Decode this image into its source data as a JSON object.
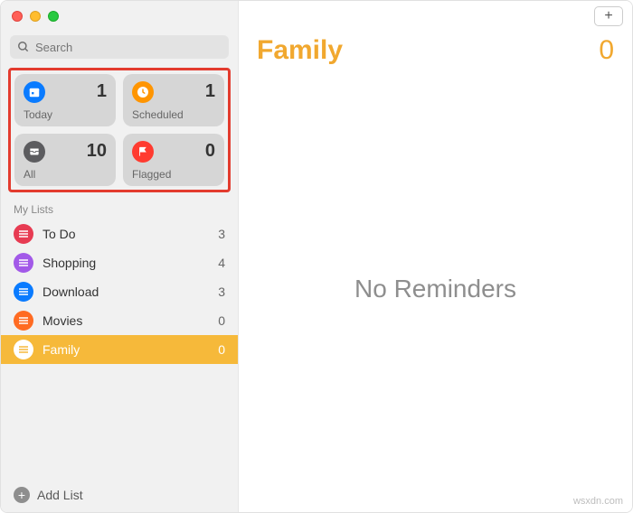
{
  "search": {
    "placeholder": "Search"
  },
  "tiles": {
    "today": {
      "label": "Today",
      "count": "1",
      "color": "#0a7bff"
    },
    "scheduled": {
      "label": "Scheduled",
      "count": "1",
      "color": "#ff9500"
    },
    "all": {
      "label": "All",
      "count": "10",
      "color": "#5c5c5f"
    },
    "flagged": {
      "label": "Flagged",
      "count": "0",
      "color": "#ff3b30"
    }
  },
  "section_title": "My Lists",
  "lists": [
    {
      "name": "To Do",
      "count": "3",
      "color": "#e73b52"
    },
    {
      "name": "Shopping",
      "count": "4",
      "color": "#a259e8"
    },
    {
      "name": "Download",
      "count": "3",
      "color": "#0a7bff"
    },
    {
      "name": "Movies",
      "count": "0",
      "color": "#ff6b22"
    },
    {
      "name": "Family",
      "count": "0",
      "color": "#f6b93a"
    }
  ],
  "add_list_label": "Add List",
  "main": {
    "title": "Family",
    "count": "0",
    "empty_text": "No Reminders"
  },
  "watermark": "wsxdn.com"
}
